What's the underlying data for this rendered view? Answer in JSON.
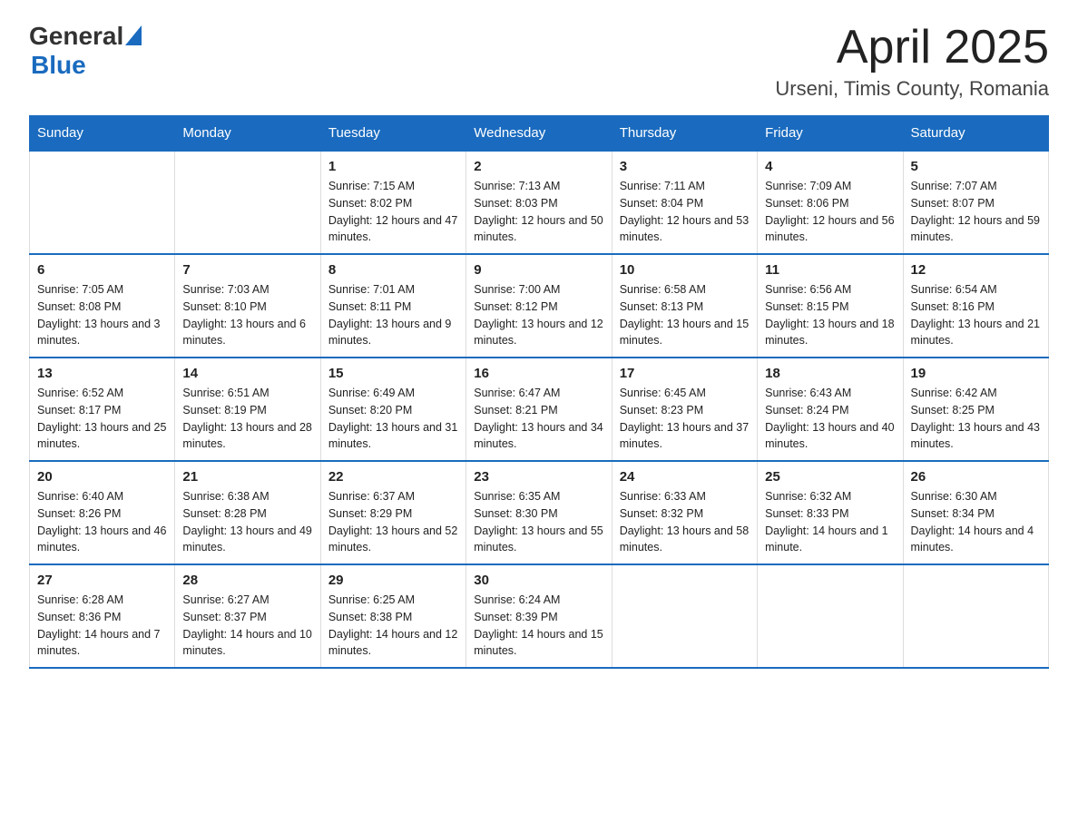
{
  "header": {
    "logo_general": "General",
    "logo_blue": "Blue",
    "title": "April 2025",
    "subtitle": "Urseni, Timis County, Romania"
  },
  "days_of_week": [
    "Sunday",
    "Monday",
    "Tuesday",
    "Wednesday",
    "Thursday",
    "Friday",
    "Saturday"
  ],
  "weeks": [
    [
      {
        "day": "",
        "sunrise": "",
        "sunset": "",
        "daylight": ""
      },
      {
        "day": "",
        "sunrise": "",
        "sunset": "",
        "daylight": ""
      },
      {
        "day": "1",
        "sunrise": "Sunrise: 7:15 AM",
        "sunset": "Sunset: 8:02 PM",
        "daylight": "Daylight: 12 hours and 47 minutes."
      },
      {
        "day": "2",
        "sunrise": "Sunrise: 7:13 AM",
        "sunset": "Sunset: 8:03 PM",
        "daylight": "Daylight: 12 hours and 50 minutes."
      },
      {
        "day": "3",
        "sunrise": "Sunrise: 7:11 AM",
        "sunset": "Sunset: 8:04 PM",
        "daylight": "Daylight: 12 hours and 53 minutes."
      },
      {
        "day": "4",
        "sunrise": "Sunrise: 7:09 AM",
        "sunset": "Sunset: 8:06 PM",
        "daylight": "Daylight: 12 hours and 56 minutes."
      },
      {
        "day": "5",
        "sunrise": "Sunrise: 7:07 AM",
        "sunset": "Sunset: 8:07 PM",
        "daylight": "Daylight: 12 hours and 59 minutes."
      }
    ],
    [
      {
        "day": "6",
        "sunrise": "Sunrise: 7:05 AM",
        "sunset": "Sunset: 8:08 PM",
        "daylight": "Daylight: 13 hours and 3 minutes."
      },
      {
        "day": "7",
        "sunrise": "Sunrise: 7:03 AM",
        "sunset": "Sunset: 8:10 PM",
        "daylight": "Daylight: 13 hours and 6 minutes."
      },
      {
        "day": "8",
        "sunrise": "Sunrise: 7:01 AM",
        "sunset": "Sunset: 8:11 PM",
        "daylight": "Daylight: 13 hours and 9 minutes."
      },
      {
        "day": "9",
        "sunrise": "Sunrise: 7:00 AM",
        "sunset": "Sunset: 8:12 PM",
        "daylight": "Daylight: 13 hours and 12 minutes."
      },
      {
        "day": "10",
        "sunrise": "Sunrise: 6:58 AM",
        "sunset": "Sunset: 8:13 PM",
        "daylight": "Daylight: 13 hours and 15 minutes."
      },
      {
        "day": "11",
        "sunrise": "Sunrise: 6:56 AM",
        "sunset": "Sunset: 8:15 PM",
        "daylight": "Daylight: 13 hours and 18 minutes."
      },
      {
        "day": "12",
        "sunrise": "Sunrise: 6:54 AM",
        "sunset": "Sunset: 8:16 PM",
        "daylight": "Daylight: 13 hours and 21 minutes."
      }
    ],
    [
      {
        "day": "13",
        "sunrise": "Sunrise: 6:52 AM",
        "sunset": "Sunset: 8:17 PM",
        "daylight": "Daylight: 13 hours and 25 minutes."
      },
      {
        "day": "14",
        "sunrise": "Sunrise: 6:51 AM",
        "sunset": "Sunset: 8:19 PM",
        "daylight": "Daylight: 13 hours and 28 minutes."
      },
      {
        "day": "15",
        "sunrise": "Sunrise: 6:49 AM",
        "sunset": "Sunset: 8:20 PM",
        "daylight": "Daylight: 13 hours and 31 minutes."
      },
      {
        "day": "16",
        "sunrise": "Sunrise: 6:47 AM",
        "sunset": "Sunset: 8:21 PM",
        "daylight": "Daylight: 13 hours and 34 minutes."
      },
      {
        "day": "17",
        "sunrise": "Sunrise: 6:45 AM",
        "sunset": "Sunset: 8:23 PM",
        "daylight": "Daylight: 13 hours and 37 minutes."
      },
      {
        "day": "18",
        "sunrise": "Sunrise: 6:43 AM",
        "sunset": "Sunset: 8:24 PM",
        "daylight": "Daylight: 13 hours and 40 minutes."
      },
      {
        "day": "19",
        "sunrise": "Sunrise: 6:42 AM",
        "sunset": "Sunset: 8:25 PM",
        "daylight": "Daylight: 13 hours and 43 minutes."
      }
    ],
    [
      {
        "day": "20",
        "sunrise": "Sunrise: 6:40 AM",
        "sunset": "Sunset: 8:26 PM",
        "daylight": "Daylight: 13 hours and 46 minutes."
      },
      {
        "day": "21",
        "sunrise": "Sunrise: 6:38 AM",
        "sunset": "Sunset: 8:28 PM",
        "daylight": "Daylight: 13 hours and 49 minutes."
      },
      {
        "day": "22",
        "sunrise": "Sunrise: 6:37 AM",
        "sunset": "Sunset: 8:29 PM",
        "daylight": "Daylight: 13 hours and 52 minutes."
      },
      {
        "day": "23",
        "sunrise": "Sunrise: 6:35 AM",
        "sunset": "Sunset: 8:30 PM",
        "daylight": "Daylight: 13 hours and 55 minutes."
      },
      {
        "day": "24",
        "sunrise": "Sunrise: 6:33 AM",
        "sunset": "Sunset: 8:32 PM",
        "daylight": "Daylight: 13 hours and 58 minutes."
      },
      {
        "day": "25",
        "sunrise": "Sunrise: 6:32 AM",
        "sunset": "Sunset: 8:33 PM",
        "daylight": "Daylight: 14 hours and 1 minute."
      },
      {
        "day": "26",
        "sunrise": "Sunrise: 6:30 AM",
        "sunset": "Sunset: 8:34 PM",
        "daylight": "Daylight: 14 hours and 4 minutes."
      }
    ],
    [
      {
        "day": "27",
        "sunrise": "Sunrise: 6:28 AM",
        "sunset": "Sunset: 8:36 PM",
        "daylight": "Daylight: 14 hours and 7 minutes."
      },
      {
        "day": "28",
        "sunrise": "Sunrise: 6:27 AM",
        "sunset": "Sunset: 8:37 PM",
        "daylight": "Daylight: 14 hours and 10 minutes."
      },
      {
        "day": "29",
        "sunrise": "Sunrise: 6:25 AM",
        "sunset": "Sunset: 8:38 PM",
        "daylight": "Daylight: 14 hours and 12 minutes."
      },
      {
        "day": "30",
        "sunrise": "Sunrise: 6:24 AM",
        "sunset": "Sunset: 8:39 PM",
        "daylight": "Daylight: 14 hours and 15 minutes."
      },
      {
        "day": "",
        "sunrise": "",
        "sunset": "",
        "daylight": ""
      },
      {
        "day": "",
        "sunrise": "",
        "sunset": "",
        "daylight": ""
      },
      {
        "day": "",
        "sunrise": "",
        "sunset": "",
        "daylight": ""
      }
    ]
  ]
}
